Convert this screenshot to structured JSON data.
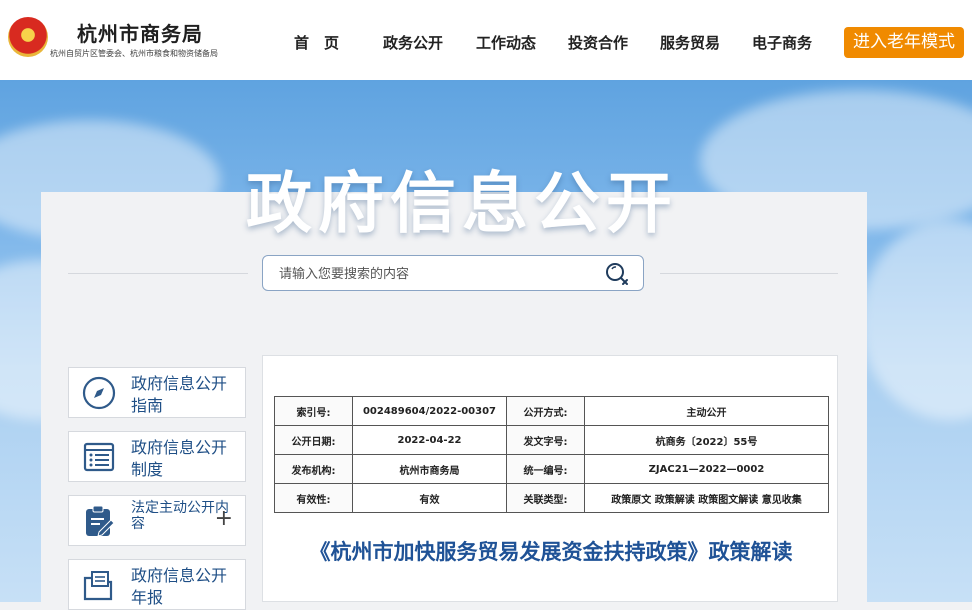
{
  "header": {
    "site_name": "杭州市商务局",
    "site_subtitle": "杭州自贸片区管委会、杭州市粮食和物资储备局",
    "emblem_icon": "national-emblem-icon",
    "nav": [
      "首　页",
      "政务公开",
      "工作动态",
      "投资合作",
      "服务贸易",
      "电子商务"
    ],
    "elder_mode_label": "进入老年模式"
  },
  "banner": {
    "title": "政府信息公开"
  },
  "search": {
    "placeholder": "请输入您要搜索的内容",
    "icon": "search-icon"
  },
  "sidebar": {
    "items": [
      {
        "label": "政府信息公开指南",
        "icon": "compass-icon"
      },
      {
        "label": "政府信息公开制度",
        "icon": "list-document-icon"
      },
      {
        "label": "法定主动公开内容",
        "icon": "clipboard-edit-icon",
        "expand": "+"
      },
      {
        "label": "政府信息公开年报",
        "icon": "folder-document-icon"
      }
    ]
  },
  "document": {
    "meta_rows": [
      {
        "k1": "索引号:",
        "v1": "002489604/2022-00307",
        "k2": "公开方式:",
        "v2": "主动公开"
      },
      {
        "k1": "公开日期:",
        "v1": "2022-04-22",
        "k2": "发文字号:",
        "v2": "杭商务〔2022〕55号"
      },
      {
        "k1": "发布机构:",
        "v1": "杭州市商务局",
        "k2": "统一编号:",
        "v2": "ZJAC21—2022—0002"
      },
      {
        "k1": "有效性:",
        "v1": "有效",
        "k2": "关联类型:",
        "v2": "政策原文 政策解读 政策图文解读 意见收集"
      }
    ],
    "title": "《杭州市加快服务贸易发展资金扶持政策》政策解读"
  },
  "colors": {
    "accent_orange": "#f08a00",
    "link_blue": "#1f4f86",
    "title_blue": "#1f5296"
  }
}
